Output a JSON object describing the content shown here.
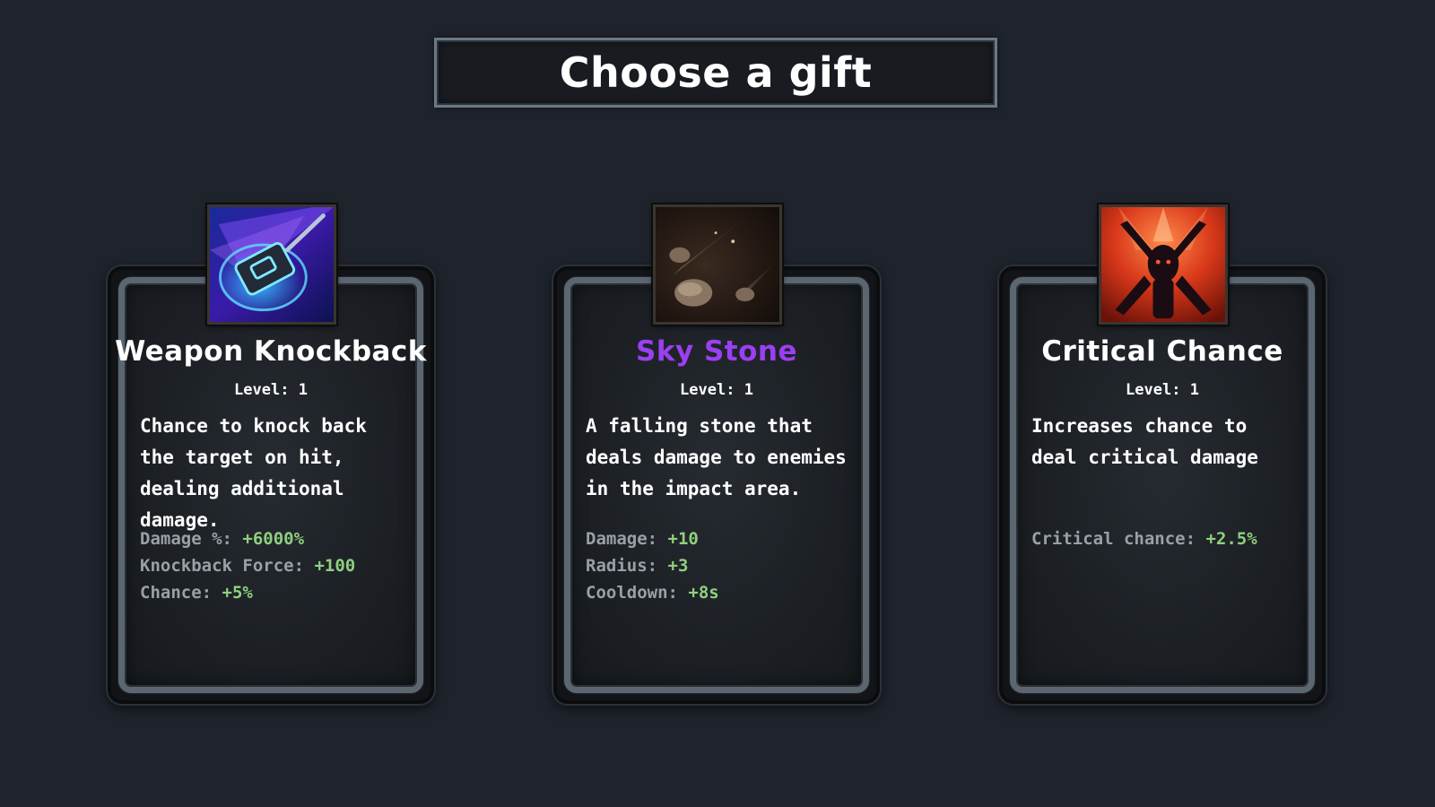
{
  "screen": {
    "title": "Choose a gift"
  },
  "colors": {
    "background": "#1f232c",
    "title_text": "#ffffff",
    "stat_label": "#9aa0a6",
    "stat_value": "#8fd07e",
    "name_default": "#ffffff",
    "name_highlight": "#9b3ff2"
  },
  "gifts": [
    {
      "name": "Weapon Knockback",
      "name_color": "#ffffff",
      "icon": "weapon-knockback-icon",
      "level": "Level: 1",
      "description": "Chance to knock back the target on hit, dealing additional damage.",
      "stats": [
        {
          "label": "Damage %:",
          "value": "+6000%"
        },
        {
          "label": "Knockback Force:",
          "value": "+100"
        },
        {
          "label": "Chance:",
          "value": "+5%"
        }
      ]
    },
    {
      "name": "Sky Stone",
      "name_color": "#9b3ff2",
      "icon": "sky-stone-icon",
      "level": "Level: 1",
      "description": "A falling stone that deals damage to enemies in the impact area.",
      "stats": [
        {
          "label": "Damage:",
          "value": "+10"
        },
        {
          "label": "Radius:",
          "value": "+3"
        },
        {
          "label": "Cooldown:",
          "value": "+8s"
        }
      ]
    },
    {
      "name": "Critical Chance",
      "name_color": "#ffffff",
      "icon": "critical-chance-icon",
      "level": "Level: 1",
      "description": "Increases chance to deal critical damage",
      "stats": [
        {
          "label": "Critical chance:",
          "value": "+2.5%"
        }
      ]
    }
  ]
}
